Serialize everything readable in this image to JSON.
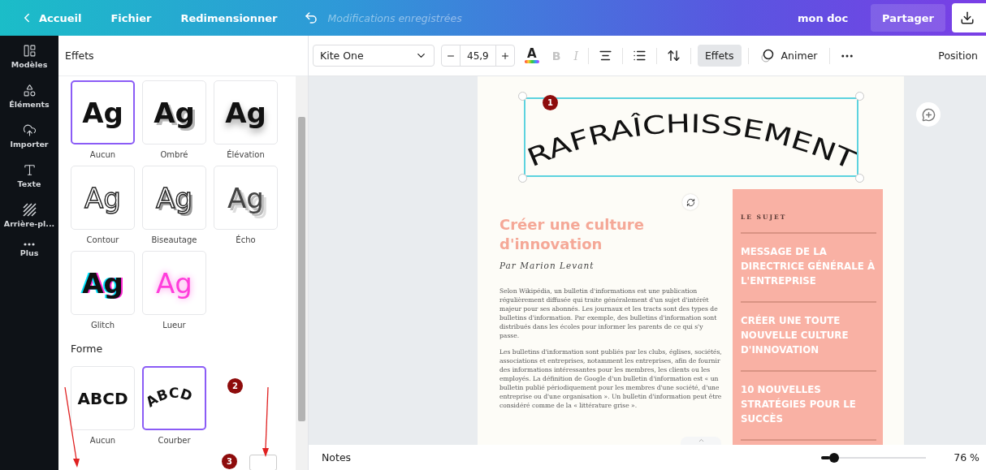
{
  "top_bar": {
    "home": "Accueil",
    "menu": [
      "Fichier",
      "Redimensionner"
    ],
    "save_status": "Modifications enregistrées",
    "doc_name": "mon doc",
    "share": "Partager"
  },
  "sidebar": {
    "items": [
      {
        "kind": "templates",
        "label": "Modèles"
      },
      {
        "kind": "elements",
        "label": "Éléments"
      },
      {
        "kind": "upload",
        "label": "Importer"
      },
      {
        "kind": "text",
        "label": "Texte"
      },
      {
        "kind": "background",
        "label": "Arrière-pl..."
      },
      {
        "kind": "more",
        "label": "Plus"
      }
    ]
  },
  "panel": {
    "title": "Effets",
    "effects": [
      {
        "kind": "none",
        "sample": "Ag",
        "label": "Aucun",
        "selected": true
      },
      {
        "kind": "shadow",
        "sample": "Ag",
        "label": "Ombré",
        "selected": false
      },
      {
        "kind": "lift",
        "sample": "Ag",
        "label": "Élévation",
        "selected": false
      },
      {
        "kind": "outline",
        "sample": "Ag",
        "label": "Contour",
        "selected": false
      },
      {
        "kind": "bevel",
        "sample": "Ag",
        "label": "Biseautage",
        "selected": false
      },
      {
        "kind": "echo",
        "sample": "Ag",
        "label": "Écho",
        "selected": false
      },
      {
        "kind": "glitch",
        "sample": "Ag",
        "label": "Glitch",
        "selected": false
      },
      {
        "kind": "glow",
        "sample": "Ag",
        "label": "Lueur",
        "selected": false
      }
    ],
    "shape_title": "Forme",
    "shapes": [
      {
        "kind": "straight",
        "sample": "ABCD",
        "label": "Aucun",
        "selected": false
      },
      {
        "kind": "curve",
        "sample": "ABCD",
        "label": "Courber",
        "selected": true
      }
    ]
  },
  "toolbar": {
    "font": "Kite One",
    "size": "45,9",
    "color_glyph": "A",
    "styles": [
      {
        "glyph": "B",
        "kind": "bold",
        "disabled": true
      },
      {
        "glyph": "I",
        "kind": "italic",
        "disabled": true
      }
    ],
    "effects_button": {
      "label": "Effets",
      "selected": true
    },
    "animate": "Animer",
    "position": "Position"
  },
  "page": {
    "heading": "RAFRAÎCHISSEMENT",
    "title": "Créer une culture d'innovation",
    "author": "Par Marion Levant",
    "paragraphs": [
      "Selon Wikipédia, un bulletin d'informations est une publication régulièrement diffusée qui traite généralement d'un sujet d'intérêt majeur pour ses abonnés. Les journaux et les tracts sont des types de bulletins d'information. Par exemple, des bulletins d'information sont distribués dans les écoles pour informer les parents de ce qui s'y passe.",
      "Les bulletins d'information sont publiés par les clubs, églises, sociétés, associations et entreprises, notamment les entreprises, afin de fournir des informations intéressantes pour les membres, les clients ou les employés. La définition de Google d'un bulletin d'information est « un bulletin publié périodiquement pour les membres d'une société, d'une entreprise ou d'une organisation ». Un bulletin d'information peut être considéré comme de la « littérature grise »."
    ],
    "sidebar_label": "LE SUJET",
    "topics": [
      "MESSAGE DE LA DIRECTRICE GÉNÉRALE À L'ENTREPRISE",
      "CRÉER UNE TOUTE NOUVELLE CULTURE D'INNOVATION",
      "10 NOUVELLES STRATÉGIES POUR LE SUCCÈS"
    ]
  },
  "annotations": [
    "1",
    "2",
    "3"
  ],
  "bottom_bar": {
    "notes": "Notes",
    "zoom": {
      "level": 0.08
    },
    "zoom_reading": "76 %"
  }
}
